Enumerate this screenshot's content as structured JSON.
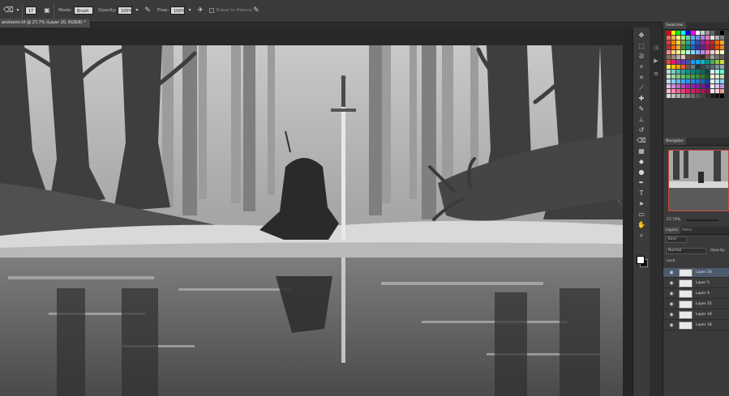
{
  "options_bar": {
    "brush_size": "17",
    "mode_label": "Mode:",
    "mode_value": "Brush",
    "opacity_label": "Opacity:",
    "opacity_value": "100%",
    "flow_label": "Flow:",
    "flow_value": "100%",
    "erase_to_history_label": "Erase to History"
  },
  "document": {
    "tab_title": "anshonin.tif @ 27,7% (Layer 20, RGB/8) *"
  },
  "tools_icons": [
    "move-icon",
    "marquee-icon",
    "lasso-icon",
    "quick-select-icon",
    "crop-icon",
    "eyedropper-icon",
    "spot-heal-icon",
    "brush-icon",
    "clone-stamp-icon",
    "history-brush-icon",
    "eraser-icon",
    "gradient-icon",
    "blur-icon",
    "dodge-icon",
    "pen-icon",
    "type-icon",
    "path-select-icon",
    "shape-icon",
    "hand-icon",
    "zoom-icon"
  ],
  "swatches_panel": {
    "tab": "Swatches"
  },
  "navigator_panel": {
    "tab": "Navigator",
    "zoom": "27,74%"
  },
  "layers_panel": {
    "tabs": [
      "Layers",
      "Paths"
    ],
    "kind_filter": "Kind",
    "blend_mode": "Normal",
    "opacity_label": "Opacity:",
    "lock_label": "Lock:",
    "layers": [
      {
        "name": "Layer 20",
        "active": true
      },
      {
        "name": "Layer 5",
        "active": false
      },
      {
        "name": "Layer 4",
        "active": false
      },
      {
        "name": "Layer 15",
        "active": false
      },
      {
        "name": "Layer 19",
        "active": false
      },
      {
        "name": "Layer 18",
        "active": false
      }
    ]
  },
  "colors": {
    "active_layer": "#4d5a6e",
    "navigator_border": "#c94a3a"
  }
}
